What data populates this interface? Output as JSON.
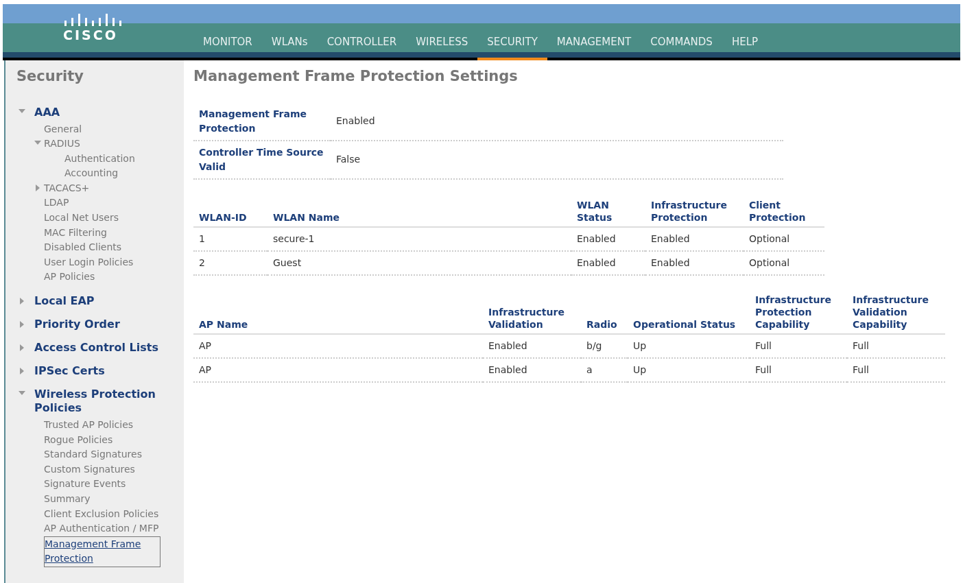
{
  "header": {
    "logo": "CISCO",
    "nav": [
      {
        "label": "MONITOR",
        "selected": false
      },
      {
        "label": "WLANs",
        "selected": false
      },
      {
        "label": "CONTROLLER",
        "selected": false
      },
      {
        "label": "WIRELESS",
        "selected": false
      },
      {
        "label": "SECURITY",
        "selected": true
      },
      {
        "label": "MANAGEMENT",
        "selected": false
      },
      {
        "label": "COMMANDS",
        "selected": false
      },
      {
        "label": "HELP",
        "selected": false
      }
    ]
  },
  "sidebar": {
    "title": "Security",
    "items": [
      {
        "label": "AAA",
        "expanded": true,
        "children": [
          {
            "label": "General",
            "selected": false
          },
          {
            "label": "RADIUS",
            "expanded": true,
            "selected": false,
            "children": [
              {
                "label": "Authentication",
                "selected": false
              },
              {
                "label": "Accounting",
                "selected": false
              }
            ]
          },
          {
            "label": "TACACS+",
            "expanded": false,
            "selected": false
          },
          {
            "label": "LDAP",
            "selected": false
          },
          {
            "label": "Local Net Users",
            "selected": false
          },
          {
            "label": "MAC Filtering",
            "selected": false
          },
          {
            "label": "Disabled Clients",
            "selected": false
          },
          {
            "label": "User Login Policies",
            "selected": false
          },
          {
            "label": "AP Policies",
            "selected": false
          }
        ]
      },
      {
        "label": "Local EAP",
        "expanded": false
      },
      {
        "label": "Priority Order",
        "expanded": false
      },
      {
        "label": "Access Control Lists",
        "expanded": false
      },
      {
        "label": "IPSec Certs",
        "expanded": false
      },
      {
        "label": "Wireless Protection Policies",
        "expanded": true,
        "children": [
          {
            "label": "Trusted AP Policies",
            "selected": false
          },
          {
            "label": "Rogue Policies",
            "selected": false
          },
          {
            "label": "Standard Signatures",
            "selected": false
          },
          {
            "label": "Custom Signatures",
            "selected": false
          },
          {
            "label": "Signature Events Summary",
            "selected": false
          },
          {
            "label": "Client Exclusion Policies",
            "selected": false
          },
          {
            "label": "AP Authentication / MFP",
            "selected": false
          },
          {
            "label": "Management Frame Protection",
            "selected": true
          }
        ]
      }
    ]
  },
  "main": {
    "title": "Management Frame Protection Settings",
    "settings": [
      {
        "label": "Management Frame Protection",
        "value": "Enabled"
      },
      {
        "label": "Controller Time Source Valid",
        "value": "False"
      }
    ],
    "wlan_table": {
      "columns": [
        "WLAN-ID",
        "WLAN Name",
        "WLAN Status",
        "Infrastructure Protection",
        "Client Protection"
      ],
      "rows": [
        [
          "1",
          "secure-1",
          "Enabled",
          "Enabled",
          "Optional"
        ],
        [
          "2",
          "Guest",
          "Enabled",
          "Enabled",
          "Optional"
        ]
      ]
    },
    "ap_table": {
      "columns": [
        "AP Name",
        "Infrastructure Validation",
        "Radio",
        "Operational Status",
        "Infrastructure Protection Capability",
        "Infrastructure Validation Capability"
      ],
      "rows": [
        [
          "AP",
          "Enabled",
          "b/g",
          "Up",
          "Full",
          "Full"
        ],
        [
          "AP",
          "Enabled",
          "a",
          "Up",
          "Full",
          "Full"
        ]
      ]
    }
  }
}
